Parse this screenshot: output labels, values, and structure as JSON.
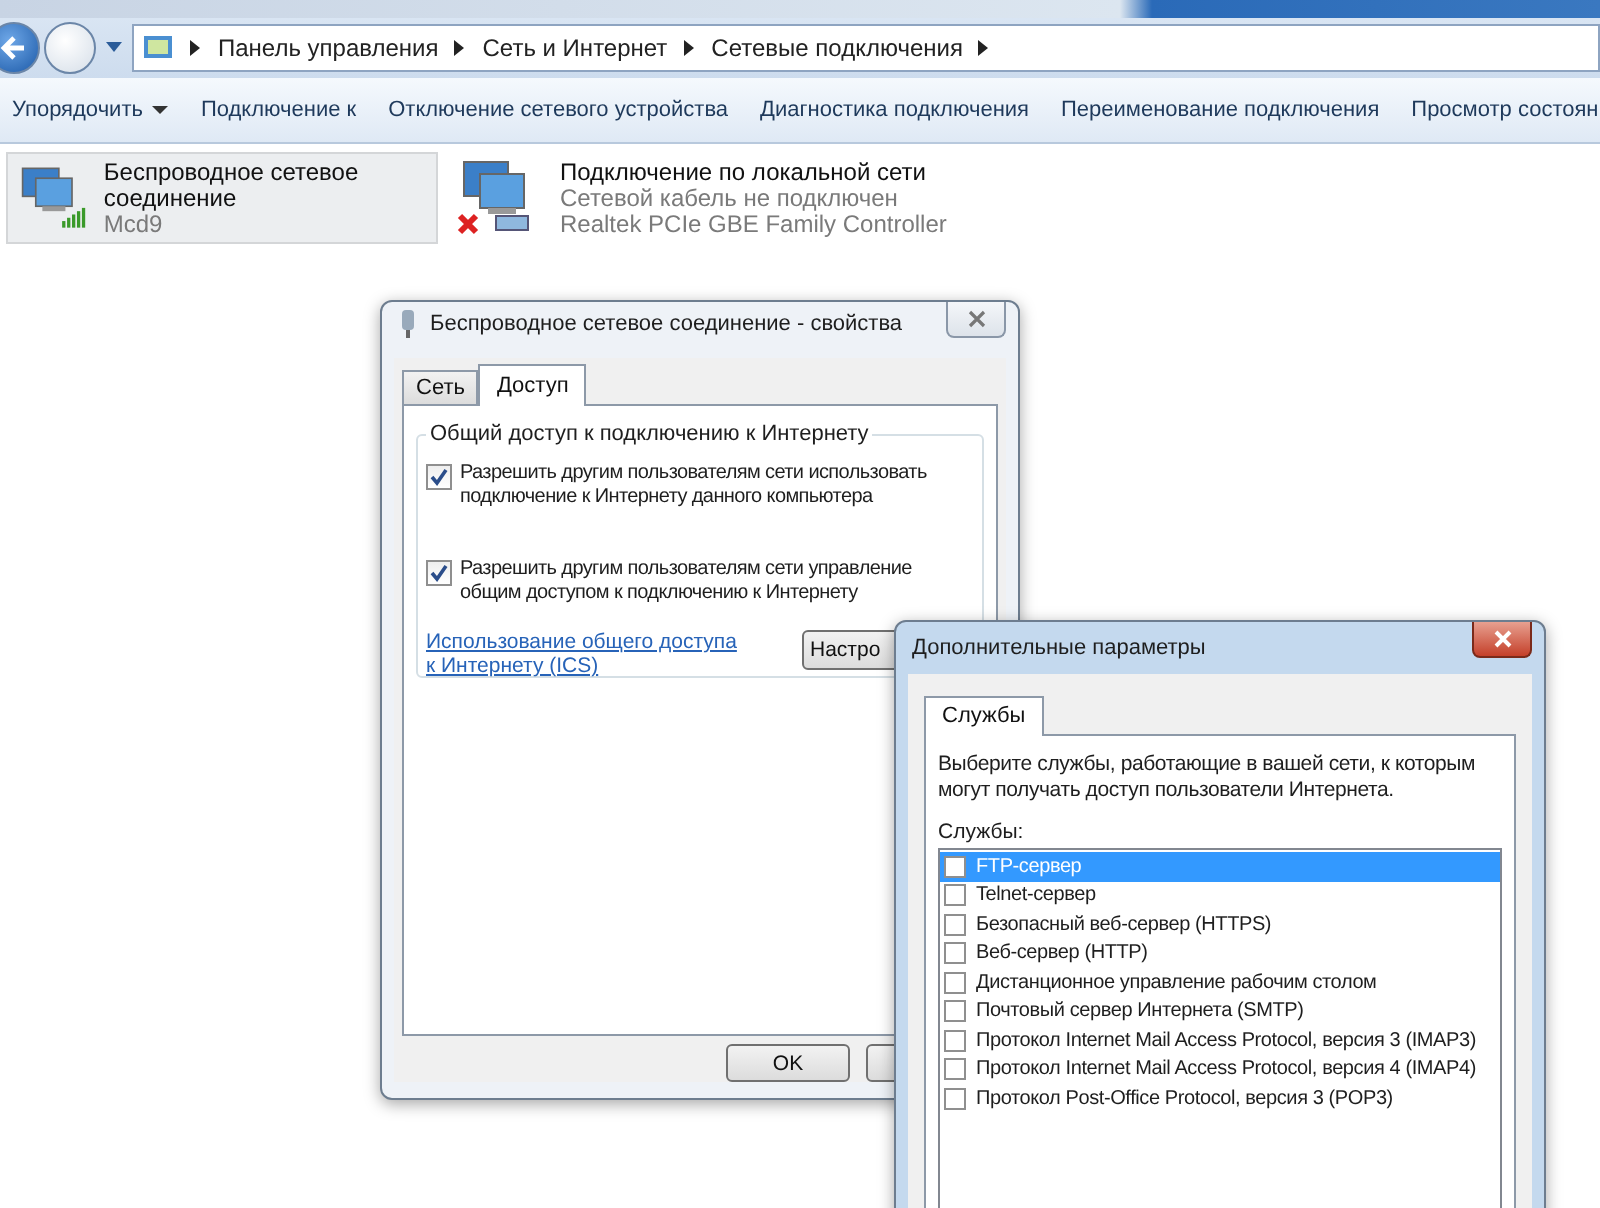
{
  "address_bar": {
    "crumbs": [
      "Панель управления",
      "Сеть и Интернет",
      "Сетевые подключения"
    ]
  },
  "toolbar": {
    "items": [
      {
        "label": "Упорядочить",
        "dropdown": true
      },
      {
        "label": "Подключение к",
        "dropdown": false
      },
      {
        "label": "Отключение сетевого устройства",
        "dropdown": false
      },
      {
        "label": "Диагностика подключения",
        "dropdown": false
      },
      {
        "label": "Переименование подключения",
        "dropdown": false
      },
      {
        "label": "Просмотр состоян",
        "dropdown": false
      }
    ]
  },
  "connections": [
    {
      "name": "Беспроводное сетевое соединение",
      "detail_1": "Mcd9",
      "kind": "wireless",
      "selected": true
    },
    {
      "name": "Подключение по локальной сети",
      "detail_1": "Сетевой кабель не подключен",
      "detail_2": "Realtek PCIe GBE Family Controller",
      "kind": "wired",
      "selected": false
    }
  ],
  "properties_dialog": {
    "title": "Беспроводное сетевое соединение - свойства",
    "tabs": [
      {
        "label": "Сеть",
        "selected": false
      },
      {
        "label": "Доступ",
        "selected": true
      }
    ],
    "group_title": "Общий доступ к подключению к Интернету",
    "options": [
      {
        "label": "Разрешить другим пользователям сети использовать подключение к Интернету данного компьютера",
        "checked": true
      },
      {
        "label": "Разрешить другим пользователям сети управление общим доступом к подключению к Интернету",
        "checked": true
      }
    ],
    "link": "Использование общего доступа к Интернету (ICS)",
    "settings_button": "Настро",
    "ok_button": "OK"
  },
  "advanced_dialog": {
    "title": "Дополнительные параметры",
    "tabs": [
      {
        "label": "Службы",
        "selected": true
      }
    ],
    "description": "Выберите службы, работающие в вашей сети, к которым могут получать доступ пользователи Интернета.",
    "list_label": "Службы:",
    "services": [
      {
        "label": "FTP-сервер",
        "checked": false,
        "selected": true
      },
      {
        "label": "Telnet-сервер",
        "checked": false,
        "selected": false
      },
      {
        "label": "Безопасный веб-сервер (HTTPS)",
        "checked": false,
        "selected": false
      },
      {
        "label": "Веб-сервер (HTTP)",
        "checked": false,
        "selected": false
      },
      {
        "label": "Дистанционное управление рабочим столом",
        "checked": false,
        "selected": false
      },
      {
        "label": "Почтовый сервер Интернета (SMTP)",
        "checked": false,
        "selected": false
      },
      {
        "label": "Протокол Internet Mail Access Protocol, версия 3 (IMAP3)",
        "checked": false,
        "selected": false
      },
      {
        "label": "Протокол Internet Mail Access Protocol, версия 4 (IMAP4)",
        "checked": false,
        "selected": false
      },
      {
        "label": "Протокол Post-Office Protocol, версия 3 (POP3)",
        "checked": false,
        "selected": false
      }
    ]
  }
}
